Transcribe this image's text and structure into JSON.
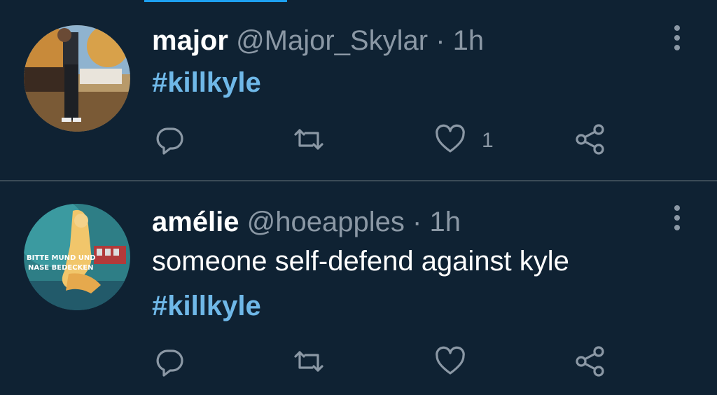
{
  "tweets": [
    {
      "name": "major",
      "handle": "@Major_Skylar",
      "separator": "·",
      "time": "1h",
      "text": "",
      "hashtag": "#killkyle",
      "like_count": "1"
    },
    {
      "name": "amélie",
      "handle": "@hoeapples",
      "separator": "·",
      "time": "1h",
      "text": "someone self-defend against kyle",
      "hashtag": "#killkyle",
      "like_count": "",
      "avatar_text_line1": "BITTE MUND UND",
      "avatar_text_line2": "NASE BEDECKEN"
    }
  ],
  "colors": {
    "background": "#0f2233",
    "hashtag": "#6fb8e8",
    "muted": "#8b98a5",
    "accent": "#1da1f2"
  },
  "icons": [
    "reply-icon",
    "retweet-icon",
    "like-icon",
    "share-icon",
    "more-options-icon"
  ]
}
